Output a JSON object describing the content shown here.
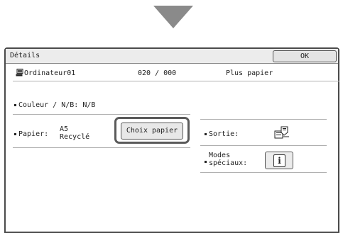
{
  "header": {
    "title": "Détails",
    "ok_label": "OK"
  },
  "job": {
    "name": "Ordinateur01",
    "count": "020 / 000",
    "status": "Plus papier"
  },
  "color": {
    "label": "Couleur / N/B:",
    "value": "N/B"
  },
  "paper": {
    "label": "Papier:",
    "size": "A5",
    "type": "Recyclé",
    "choice_button": "Choix papier"
  },
  "output": {
    "label": "Sortie:"
  },
  "special_modes": {
    "label_line1": "Modes",
    "label_line2": "spéciaux:",
    "button_icon_text": "i"
  },
  "icons": [
    "down-arrow-icon",
    "computer-icon",
    "output-tray-icon",
    "info-icon"
  ],
  "colors": {
    "arrow": "#8a8a8a",
    "frame": "#4a4a4a",
    "button_bg": "#e8e8e8"
  }
}
